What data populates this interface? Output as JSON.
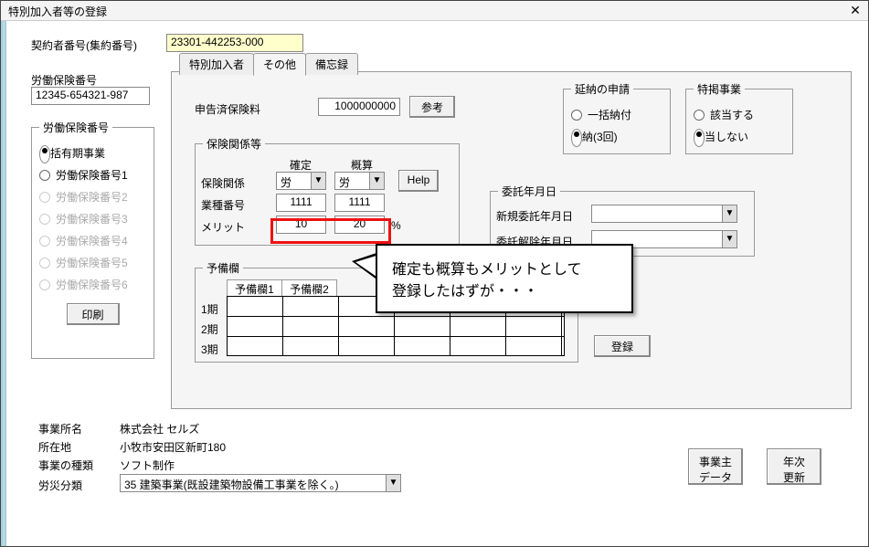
{
  "window": {
    "title": "特別加入者等の登録"
  },
  "top": {
    "contract_no_label": "契約者番号(集約番号)",
    "contract_no_value": "23301-442253-000",
    "labor_ins_no_label": "労働保険番号",
    "labor_ins_no_value": "12345-654321-987"
  },
  "labor_group": {
    "title": "労働保険番号",
    "items": [
      {
        "label": "一括有期事業",
        "selected": true,
        "enabled": true
      },
      {
        "label": "労働保険番号1",
        "selected": false,
        "enabled": true
      },
      {
        "label": "労働保険番号2",
        "selected": false,
        "enabled": false
      },
      {
        "label": "労働保険番号3",
        "selected": false,
        "enabled": false
      },
      {
        "label": "労働保険番号4",
        "selected": false,
        "enabled": false
      },
      {
        "label": "労働保険番号5",
        "selected": false,
        "enabled": false
      },
      {
        "label": "労働保険番号6",
        "selected": false,
        "enabled": false
      }
    ],
    "print_btn": "印刷"
  },
  "tabs": [
    {
      "label": "特別加入者",
      "active": false
    },
    {
      "label": "その他",
      "active": true
    },
    {
      "label": "備忘録",
      "active": false
    }
  ],
  "declared": {
    "label": "申告済保険料",
    "value": "1000000000",
    "ref_btn": "参考"
  },
  "deferral": {
    "title": "延納の申請",
    "items": [
      {
        "label": "一括納付",
        "selected": false
      },
      {
        "label": "分納(3回)",
        "selected": true
      }
    ]
  },
  "special_biz": {
    "title": "特掲事業",
    "items": [
      {
        "label": "該当する",
        "selected": false
      },
      {
        "label": "該当しない",
        "selected": true
      }
    ]
  },
  "relation": {
    "title": "保険関係等",
    "col_kakutei": "確定",
    "col_gaisan": "概算",
    "row_relation": "保険関係",
    "relation_kakutei": "労",
    "relation_gaisan": "労",
    "row_industry": "業種番号",
    "industry_kakutei": "1111",
    "industry_gaisan": "1111",
    "row_merit": "メリット",
    "merit_kakutei": "10",
    "merit_gaisan": "20",
    "pct": "%",
    "help_btn": "Help"
  },
  "entrust": {
    "title": "委託年月日",
    "new_label": "新規委託年月日",
    "cancel_label": "委託解除年月日",
    "new_value": "",
    "cancel_value": ""
  },
  "reserve": {
    "title": "予備欄",
    "col1": "予備欄1",
    "col2": "予備欄2",
    "rows": [
      "1期",
      "2期",
      "3期"
    ]
  },
  "register_btn": "登録",
  "callout": {
    "line1": "確定も概算もメリットとして",
    "line2": "登録したはずが・・・"
  },
  "footer": {
    "office_label": "事業所名",
    "office_value": "株式会社 セルズ",
    "addr_label": "所在地",
    "addr_value": "小牧市安田区新町180",
    "kind_label": "事業の種類",
    "kind_value": "ソフト制作",
    "class_label": "労災分類",
    "class_value": "35 建築事業(既設建築物設備工事業を除く。)",
    "owner_btn": "事業主\nデータ",
    "annual_btn": "年次\n更新"
  }
}
